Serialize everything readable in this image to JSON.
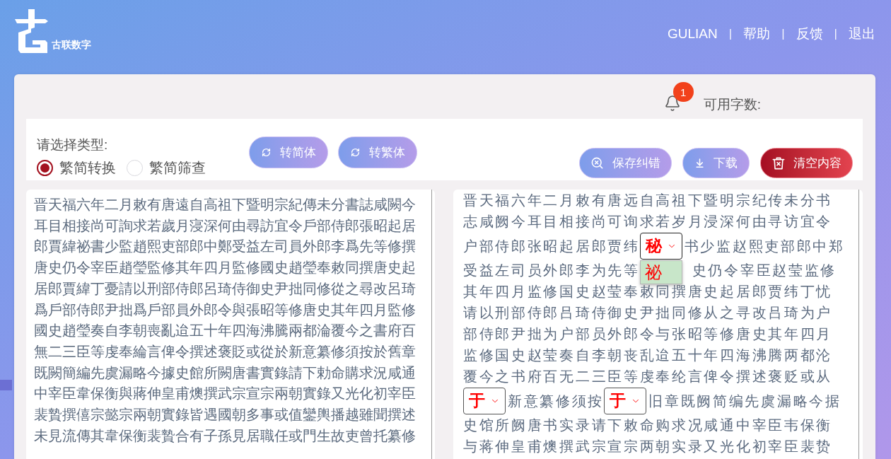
{
  "header": {
    "logo_text": "古联数字",
    "nav": [
      {
        "kind": "link",
        "label": "GULIAN"
      },
      {
        "kind": "separator",
        "label": "|"
      },
      {
        "kind": "link",
        "label": "帮助"
      },
      {
        "kind": "separator",
        "label": "|"
      },
      {
        "kind": "link",
        "label": "反馈"
      },
      {
        "kind": "separator",
        "label": "|"
      },
      {
        "kind": "link",
        "label": "退出"
      }
    ]
  },
  "toolbar": {
    "notification_count": "1",
    "word_count_label": "可用字数:"
  },
  "conversion": {
    "label": "请选择类型:",
    "options": [
      {
        "label": "繁简转换",
        "selected": true
      },
      {
        "label": "繁简筛查",
        "selected": false
      }
    ],
    "buttons": [
      {
        "label": "转简体"
      },
      {
        "label": "转繁体"
      }
    ]
  },
  "actions": [
    {
      "kind": "save",
      "label": "保存纠错"
    },
    {
      "kind": "download",
      "label": "下载"
    },
    {
      "kind": "clear",
      "label": "清空内容"
    }
  ],
  "source_text": "晋天福六年二月敕有唐遠自高祖下暨明宗紀傳未分書誌咸闕今耳目相接尚可詢求若歲月寖深何由尋訪宜令戶部侍郎張昭起居郎賈緯祕書少監趙熙吏部郎中鄭受益左司員外郎李爲先等修撰唐史仍令宰臣趙瑩監修其年四月監修國史趙瑩奉敕同撰唐史起居郎賈緯丁憂請以刑部侍郎呂琦侍御史尹拙同修從之尋改呂琦爲戶部侍郎尹拙爲戶部員外郎令與張昭等修唐史其年四月監修國史趙瑩奏自李朝喪亂迨五十年四海沸騰兩都淪覆今之書府百無二三臣等虔奉綸言俾令撰述褒貶或從於新意纂修須按於舊章既闕簡編先虞漏略今據史館所闕唐書實錄請下勅命購求況咸通中宰臣韋保衡與蔣伸皇甫燠撰武宗宣宗兩朝實錄又光化初宰臣裴贄撰僖宗懿宗兩朝實錄皆遇國朝多事或值鑾輿播越雖聞撰述未見流傳其韋保衡裴贄合有子孫見居職任或門生故吏曾托纂修",
  "result_lines": [
    {
      "segments": [
        {
          "kind": "text",
          "text": "晋天福六年二月敕有唐远自高祖下暨明宗纪传未分书"
        }
      ]
    },
    {
      "segments": [
        {
          "kind": "text",
          "text": "志咸阙今耳目相接尚可询求若岁月浸深何由寻访宜令"
        }
      ]
    },
    {
      "segments": [
        {
          "kind": "text",
          "text": "户部侍郎张昭起居郎贾纬"
        },
        {
          "kind": "select",
          "value": "秘",
          "expanded": true,
          "options": [
            {
              "label": "祕"
            }
          ]
        },
        {
          "kind": "text",
          "text": "书少监赵熙吏部郎中郑"
        }
      ]
    },
    {
      "segments": [
        {
          "kind": "text",
          "text": "受益左司员外郎李为先等"
        },
        {
          "kind": "covered"
        },
        {
          "kind": "text",
          "text": "史仍令宰臣赵莹监修"
        }
      ]
    },
    {
      "segments": [
        {
          "kind": "text",
          "text": "其年四月监修国史赵莹奉敕同撰唐史起居郎贾纬丁忧"
        }
      ]
    },
    {
      "segments": [
        {
          "kind": "text",
          "text": "请以刑部侍郎吕琦侍御史尹拙同修从之寻改吕琦为户"
        }
      ]
    },
    {
      "segments": [
        {
          "kind": "text",
          "text": "部侍郎尹拙为户部员外郎令与张昭等修唐史其年四月"
        }
      ]
    },
    {
      "segments": [
        {
          "kind": "text",
          "text": "监修国史赵莹奏自李朝丧乱迨五十年四海沸腾两都沦"
        }
      ]
    },
    {
      "segments": [
        {
          "kind": "text",
          "text": "覆今之书府百无二三臣等虔奉纶言俾令撰述褒贬或从"
        }
      ]
    },
    {
      "segments": [
        {
          "kind": "select",
          "value": "于",
          "expanded": false
        },
        {
          "kind": "text",
          "text": "新意纂修须按"
        },
        {
          "kind": "select",
          "value": "于",
          "expanded": false
        },
        {
          "kind": "text",
          "text": "旧章既阙简编先虞漏略今据"
        }
      ]
    },
    {
      "segments": [
        {
          "kind": "text",
          "text": "史馆所阙唐书实录请下敕命购求况咸通中宰臣韦保衡"
        }
      ]
    },
    {
      "segments": [
        {
          "kind": "text",
          "text": "与蒋伸皇甫燠撰武宗宣宗两朝实录又光化初宰臣裴贽"
        }
      ]
    }
  ]
}
